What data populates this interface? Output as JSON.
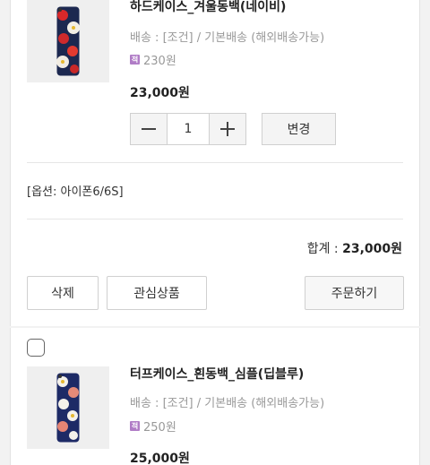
{
  "cart_items": [
    {
      "title": "하드케이스_겨울동백(네이비)",
      "shipping": "배송 : [조건] / 기본배송 (해외배송가능)",
      "points_icon": "적",
      "points": "230원",
      "price": "23,000원",
      "quantity": "1",
      "change_label": "변경",
      "option": "[옵션: 아이폰6/6S]",
      "total_label": "합계 : ",
      "total_value": "23,000원",
      "delete_label": "삭제",
      "wishlist_label": "관심상품",
      "order_label": "주문하기"
    },
    {
      "title": "터프케이스_흰동백_심플(딥블루)",
      "shipping": "배송 : [조건] / 기본배송 (해외배송가능)",
      "points_icon": "적",
      "points": "250원",
      "price": "25,000원"
    }
  ],
  "colors": {
    "points_icon": "#b07cc6",
    "border": "#d0d0d0",
    "button_bg": "#f4f4f4"
  },
  "icons": {
    "minus": "minus-icon",
    "plus": "plus-icon",
    "checkbox": "checkbox"
  }
}
